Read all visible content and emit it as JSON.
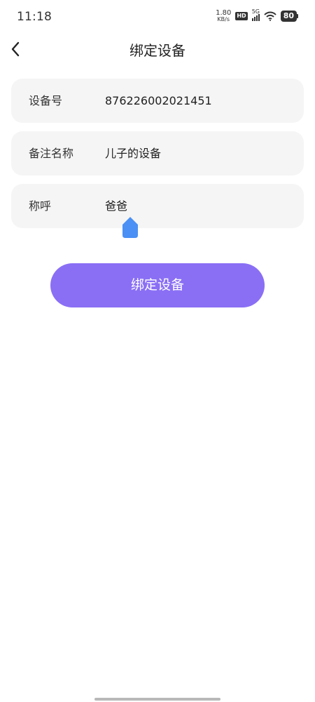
{
  "status_bar": {
    "time": "11:18",
    "net_speed_value": "1.80",
    "net_speed_unit": "KB/s",
    "hd_badge": "HD",
    "network": "5G",
    "battery": "80"
  },
  "header": {
    "title": "绑定设备",
    "back_icon": "chevron-left-icon"
  },
  "form": {
    "device_id": {
      "label": "设备号",
      "value": "876226002021451"
    },
    "remark_name": {
      "label": "备注名称",
      "value": "儿子的设备"
    },
    "relationship": {
      "label": "称呼",
      "value": "爸爸"
    }
  },
  "submit_button": {
    "label": "绑定设备"
  },
  "colors": {
    "accent": "#8a6ff5",
    "cursor_handle": "#4a90f5",
    "row_background": "#f5f5f5"
  }
}
